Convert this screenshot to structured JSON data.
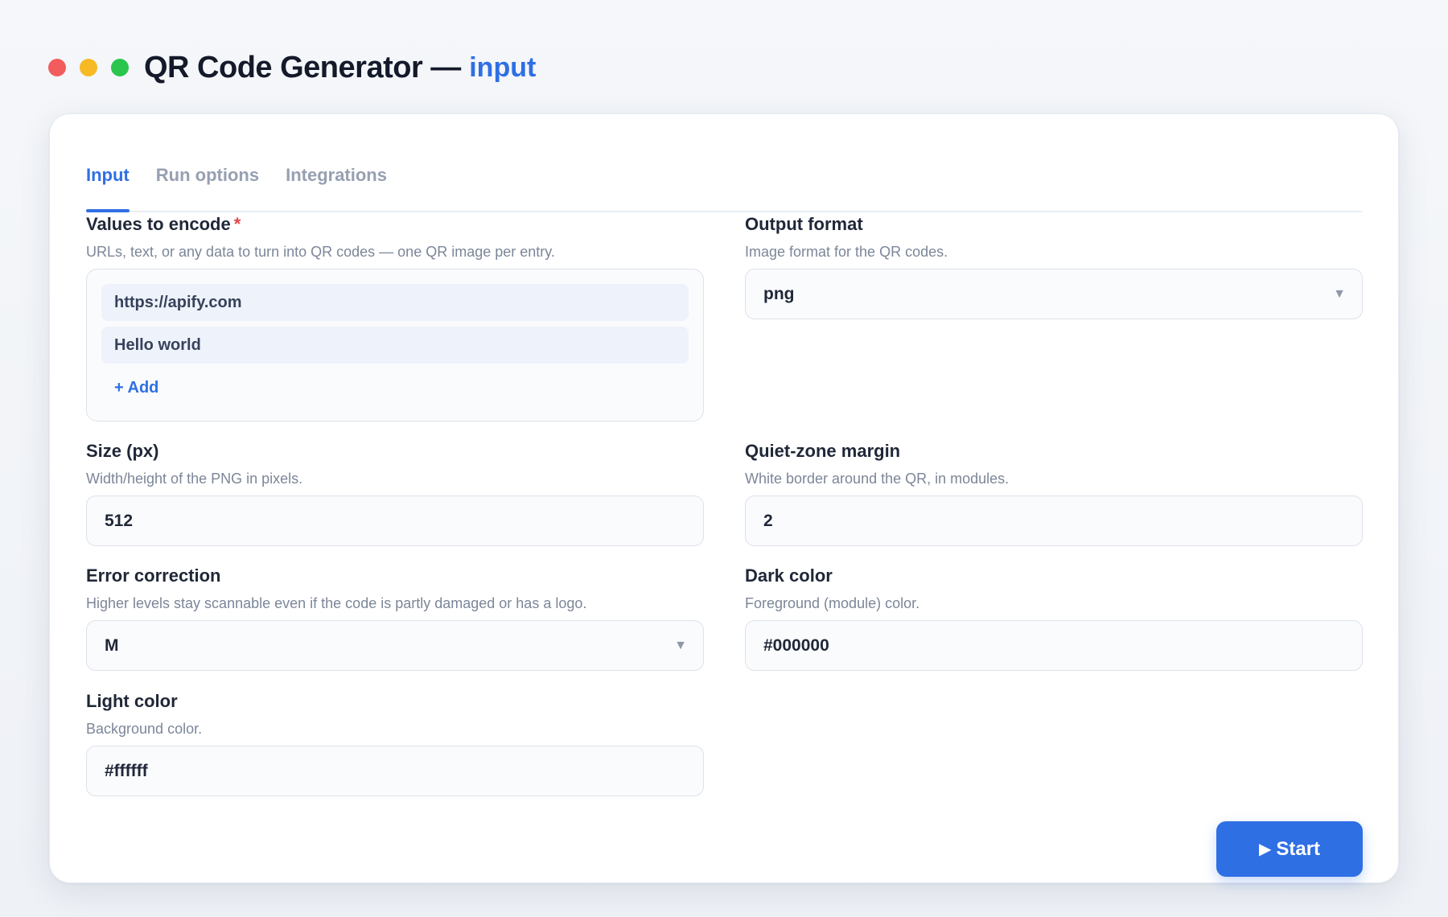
{
  "window": {
    "title": "QR Code Generator",
    "separator": "—",
    "subtitle": "input"
  },
  "tabs": [
    {
      "label": "Input",
      "active": true
    },
    {
      "label": "Run options",
      "active": false
    },
    {
      "label": "Integrations",
      "active": false
    }
  ],
  "fields": {
    "values": {
      "label": "Values to encode",
      "required_mark": "*",
      "help": "URLs, text, or any data to turn into QR codes — one QR image per entry.",
      "items": [
        "https://apify.com",
        "Hello world"
      ],
      "add_label": "+ Add"
    },
    "output_format": {
      "label": "Output format",
      "help": "Image format for the QR codes.",
      "value": "png"
    },
    "size": {
      "label": "Size (px)",
      "help": "Width/height of the PNG in pixels.",
      "value": "512"
    },
    "margin": {
      "label": "Quiet-zone margin",
      "help": "White border around the QR, in modules.",
      "value": "2"
    },
    "error_correction": {
      "label": "Error correction",
      "help": "Higher levels stay scannable even if the code is partly damaged or has a logo.",
      "value": "M"
    },
    "dark_color": {
      "label": "Dark color",
      "help": "Foreground (module) color.",
      "value": "#000000"
    },
    "light_color": {
      "label": "Light color",
      "help": "Background color.",
      "value": "#ffffff"
    }
  },
  "actions": {
    "start_icon": "▶",
    "start_label": "Start"
  },
  "colors": {
    "accent": "#2f6fe4",
    "required": "#e04848",
    "traffic_red": "#f25c5c",
    "traffic_yellow": "#f7b924",
    "traffic_green": "#2bc54e"
  }
}
